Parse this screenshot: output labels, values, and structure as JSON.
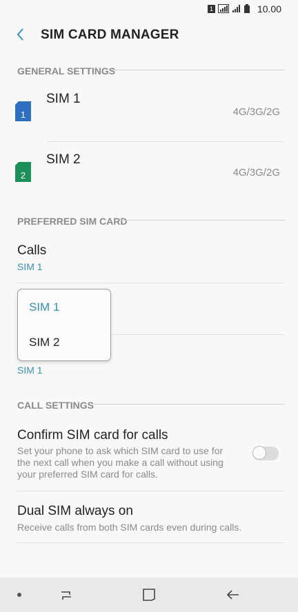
{
  "status_bar": {
    "time": "10.00",
    "sim_indicator": "1"
  },
  "header": {
    "title": "SIM CARD MANAGER",
    "back_icon": "chevron-left-icon"
  },
  "general_settings": {
    "heading": "GENERAL SETTINGS",
    "sims": [
      {
        "name": "SIM 1",
        "number": "1",
        "tech": "4G/3G/2G",
        "color": "#2e6fbf"
      },
      {
        "name": "SIM 2",
        "number": "2",
        "tech": "4G/3G/2G",
        "color": "#1f8f5a"
      }
    ]
  },
  "preferred_sim": {
    "heading": "PREFERRED SIM CARD",
    "calls": {
      "title": "Calls",
      "value": "SIM 1"
    },
    "second_value": "SIM 1",
    "dropdown": {
      "options": [
        "SIM 1",
        "SIM 2"
      ],
      "selected": "SIM 1"
    }
  },
  "call_settings": {
    "heading": "CALL SETTINGS",
    "confirm": {
      "title": "Confirm SIM card for calls",
      "line1": "Set your phone to ask which SIM card to use for",
      "line2": "the next call when you make a call without using",
      "line3": "your preferred SIM card for calls.",
      "enabled": false
    },
    "dual": {
      "title": "Dual SIM always on",
      "desc": "Receive calls from both SIM cards even during calls."
    }
  },
  "colors": {
    "accent": "#3a8fb0",
    "text": "#222222",
    "muted": "#8a8a8a"
  }
}
